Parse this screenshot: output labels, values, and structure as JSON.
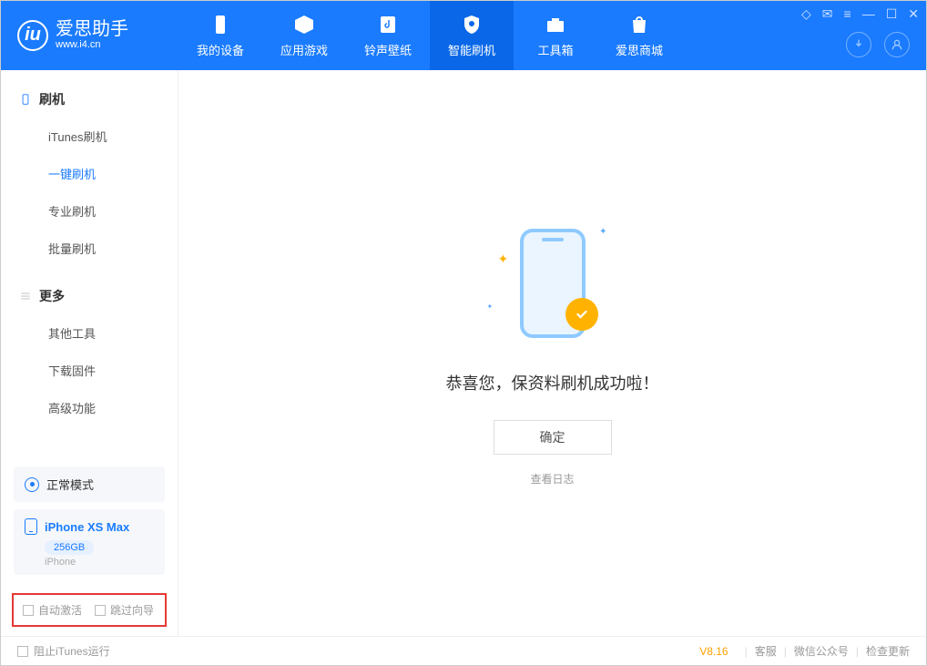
{
  "app": {
    "title": "爱思助手",
    "url": "www.i4.cn"
  },
  "nav": {
    "tabs": [
      {
        "label": "我的设备"
      },
      {
        "label": "应用游戏"
      },
      {
        "label": "铃声壁纸"
      },
      {
        "label": "智能刷机"
      },
      {
        "label": "工具箱"
      },
      {
        "label": "爱思商城"
      }
    ]
  },
  "sidebar": {
    "section1_title": "刷机",
    "section1_items": [
      "iTunes刷机",
      "一键刷机",
      "专业刷机",
      "批量刷机"
    ],
    "section2_title": "更多",
    "section2_items": [
      "其他工具",
      "下载固件",
      "高级功能"
    ]
  },
  "device": {
    "mode": "正常模式",
    "name": "iPhone XS Max",
    "storage": "256GB",
    "type": "iPhone"
  },
  "options": {
    "opt1": "自动激活",
    "opt2": "跳过向导"
  },
  "main": {
    "success_msg": "恭喜您，保资料刷机成功啦！",
    "ok_btn": "确定",
    "view_log": "查看日志"
  },
  "footer": {
    "block_itunes": "阻止iTunes运行",
    "version": "V8.16",
    "links": [
      "客服",
      "微信公众号",
      "检查更新"
    ]
  }
}
